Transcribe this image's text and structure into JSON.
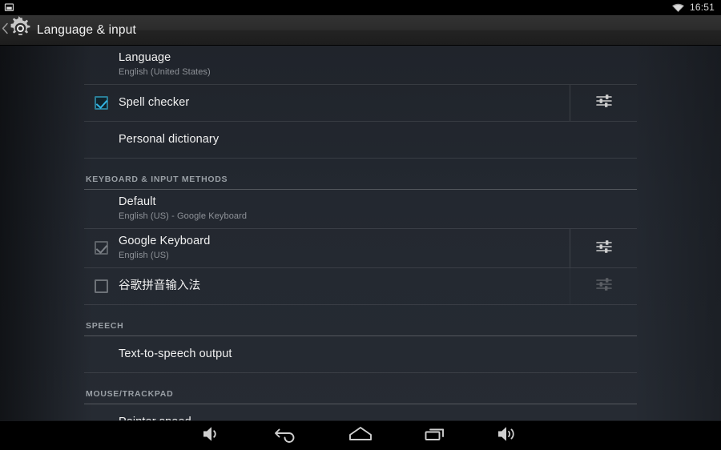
{
  "status_bar": {
    "left_icon": "screenshot-icon",
    "wifi_icon": "wifi-icon",
    "time": "16:51"
  },
  "action_bar": {
    "up_icon": "chevron-left-icon",
    "app_icon": "settings-gear-icon",
    "title": "Language & input"
  },
  "colors": {
    "accent": "#33b5e5",
    "background": "#262b33",
    "action_bar": "#2c2c2c",
    "title_text": "#f0f0f0",
    "subtitle_text": "#8e9298",
    "section_header_text": "#9aa0a6"
  },
  "list": [
    {
      "kind": "item",
      "name": "language",
      "title": "Language",
      "subtitle": "English (United States)",
      "checkbox": null,
      "widget": null
    },
    {
      "kind": "item",
      "name": "spell-checker",
      "title": "Spell checker",
      "subtitle": "",
      "checkbox": "checked",
      "widget": "sliders-settings-icon"
    },
    {
      "kind": "item",
      "name": "personal-dictionary",
      "title": "Personal dictionary",
      "subtitle": "",
      "checkbox": null,
      "widget": null
    },
    {
      "kind": "header",
      "name": "keyboard-and-input-methods",
      "title": "KEYBOARD & INPUT METHODS"
    },
    {
      "kind": "item",
      "name": "default-keyboard",
      "title": "Default",
      "subtitle": "English (US) - Google Keyboard",
      "checkbox": null,
      "widget": null
    },
    {
      "kind": "item",
      "name": "google-keyboard",
      "title": "Google Keyboard",
      "subtitle": "English (US)",
      "checkbox": "checked-disabled",
      "widget": "sliders-settings-icon"
    },
    {
      "kind": "item",
      "name": "google-pinyin-input",
      "title": "谷歌拼音输入法",
      "subtitle": "",
      "checkbox": "unchecked",
      "widget": "sliders-settings-icon-disabled"
    },
    {
      "kind": "header",
      "name": "speech",
      "title": "SPEECH"
    },
    {
      "kind": "item",
      "name": "text-to-speech-output",
      "title": "Text-to-speech output",
      "subtitle": "",
      "checkbox": null,
      "widget": null
    },
    {
      "kind": "header",
      "name": "mouse-trackpad",
      "title": "MOUSE/TRACKPAD"
    },
    {
      "kind": "item",
      "name": "pointer-speed",
      "title": "Pointer speed",
      "subtitle": "",
      "checkbox": null,
      "widget": null
    }
  ],
  "nav_bar": {
    "buttons": [
      {
        "name": "volume-down-button",
        "icon": "volume-down-icon"
      },
      {
        "name": "back-button",
        "icon": "back-arrow-icon"
      },
      {
        "name": "home-button",
        "icon": "home-icon"
      },
      {
        "name": "recents-button",
        "icon": "recents-icon"
      },
      {
        "name": "volume-up-button",
        "icon": "volume-up-icon"
      }
    ]
  }
}
